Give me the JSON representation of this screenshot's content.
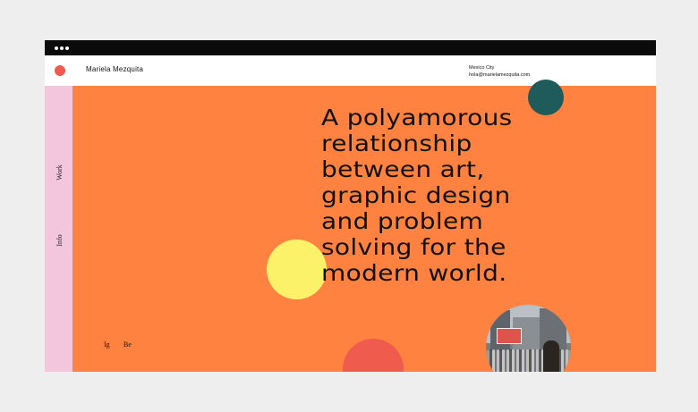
{
  "header": {
    "site_name": "Mariela Mezquita",
    "location": "Mexico City",
    "email": "hola@marielamezquita.com"
  },
  "sidebar": {
    "items": [
      {
        "label": "Work"
      },
      {
        "label": "Info"
      }
    ]
  },
  "hero": {
    "headline_lines": [
      "A polyamorous",
      "relationship",
      "between art,",
      "graphic design",
      "and problem",
      "solving for the",
      "modern world."
    ]
  },
  "social": {
    "instagram": "Ig",
    "behance": "Be"
  },
  "colors": {
    "background": "#ff8240",
    "sidebar": "#f3c6dc",
    "yellow_circle": "#fbf26a",
    "teal_circle": "#1f5b5a",
    "red_circle": "#ef5b4c"
  }
}
